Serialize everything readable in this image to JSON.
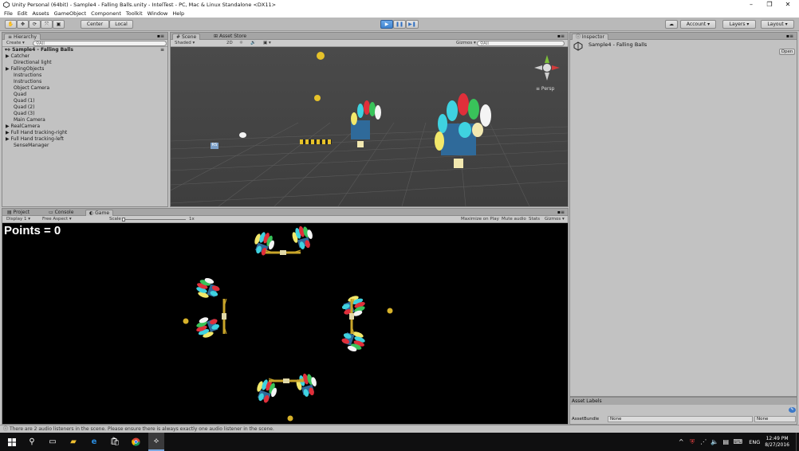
{
  "window": {
    "title": "Unity Personal (64bit) - Sample4 - Falling Balls.unity - IntelTest - PC, Mac & Linux Standalone <DX11>",
    "min": "–",
    "max": "❐",
    "close": "✕"
  },
  "menu": [
    "File",
    "Edit",
    "Assets",
    "GameObject",
    "Component",
    "Toolkit",
    "Window",
    "Help"
  ],
  "toolbar": {
    "center": "Center",
    "local": "Local",
    "account": "Account",
    "layers": "Layers",
    "layout": "Layout"
  },
  "hierarchy": {
    "tab": "Hierarchy",
    "create": "Create ▾",
    "search": "All",
    "scene": "Sample4 - Falling Balls",
    "items": [
      {
        "label": "Catcher",
        "arrow": "▶"
      },
      {
        "label": "Directional light",
        "arrow": ""
      },
      {
        "label": "FallingObjects",
        "arrow": "▶"
      },
      {
        "label": "Instructions",
        "arrow": ""
      },
      {
        "label": "Instructions",
        "arrow": ""
      },
      {
        "label": "Object Camera",
        "arrow": ""
      },
      {
        "label": "Quad",
        "arrow": ""
      },
      {
        "label": "Quad (1)",
        "arrow": ""
      },
      {
        "label": "Quad (2)",
        "arrow": ""
      },
      {
        "label": "Quad (3)",
        "arrow": ""
      },
      {
        "label": "Main Camera",
        "arrow": ""
      },
      {
        "label": "RealCamera",
        "arrow": "▶"
      },
      {
        "label": "Full Hand tracking-right",
        "arrow": "▶"
      },
      {
        "label": "Full Hand tracking-left",
        "arrow": "▶"
      },
      {
        "label": "SenseManager",
        "arrow": ""
      }
    ]
  },
  "scene": {
    "tab": "Scene",
    "asset_store_tab": "Asset Store",
    "shading": "Shaded",
    "mode2d": "2D",
    "gizmos": "Gizmos ▾",
    "search": "All",
    "persp": "≡ Persp"
  },
  "inspector": {
    "tab": "Inspector",
    "object": "Sample4 - Falling Balls",
    "open": "Open"
  },
  "game": {
    "tabs": [
      "Project",
      "Console",
      "Game"
    ],
    "display": "Display 1 ▾",
    "aspect": "Free Aspect ▾",
    "scale_label": "Scale",
    "scale_value": "1x",
    "options": [
      "Maximize on Play",
      "Mute audio",
      "Stats",
      "Gizmos ▾"
    ],
    "points": "Points = 0"
  },
  "asset_labels": {
    "title": "Asset Labels",
    "bundle_label": "AssetBundle",
    "bundle_value": "None",
    "variant_value": "None"
  },
  "status": {
    "message": "There are 2 audio listeners in the scene. Please ensure there is always exactly one audio listener in the scene."
  },
  "taskbar": {
    "lang": "ENG",
    "time": "12:49 PM",
    "date": "8/27/2016"
  }
}
